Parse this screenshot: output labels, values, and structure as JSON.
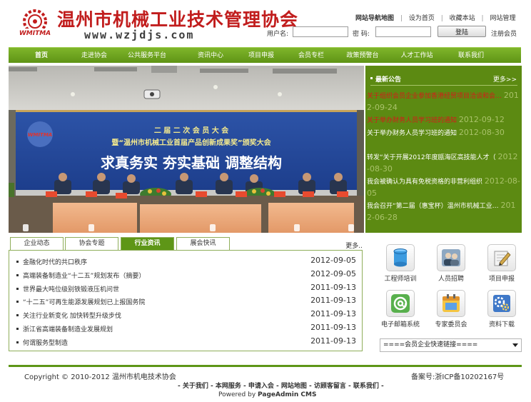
{
  "header": {
    "logo_text": "WMITMA",
    "site_title": "温州市机械工业技术管理协会",
    "site_url": "www.wzjdjs.com",
    "top_links": [
      "网站导航地图",
      "设为首页",
      "收藏本站",
      "网站管理"
    ],
    "username_label": "用户名:",
    "password_label": "密  码:",
    "username_value": "",
    "password_value": "",
    "login_button": "登陆",
    "register_link": "注册会员"
  },
  "nav": {
    "items": [
      "首页",
      "走进协会",
      "公共服务平台",
      "资讯中心",
      "项目申报",
      "会员专栏",
      "政策预警台",
      "人才工作站",
      "联系我们"
    ]
  },
  "banner": {
    "line1": "二 届 二 次 会 员 大 会",
    "line2": "暨“温州市机械工业首届产品创新成果奖”颁奖大会",
    "slogan": "求真务实   夯实基础   调整结构",
    "logo_text": "WMITMA"
  },
  "news": {
    "title": "最新公告",
    "more": "更多>>",
    "items": [
      {
        "title": "关于组织会员企业参加香港经贸项目洽谈和会…",
        "date": "2012-09-24",
        "red": true
      },
      {
        "title": "关于举办财务人员学习班的通知",
        "date": "2012-09-12",
        "red": true
      },
      {
        "title": "关于举办财务人员学习班的通知",
        "date": "2012-08-30",
        "red": false
      },
      {
        "title": "转发“关于开展2012年度瓯海区高技能人才（",
        "date": "2012-08-30",
        "red": false
      },
      {
        "title": "我会被确认为具有免税资格的非营利组织",
        "date": "2012-08-05",
        "red": false
      },
      {
        "title": "我会召开“第二届（惠宝杯）温州市机械工业…",
        "date": "2012-06-28",
        "red": false
      }
    ]
  },
  "tabs": {
    "items": [
      "企业动态",
      "协会专题",
      "行业资讯",
      "展会快讯"
    ],
    "active_index": 2,
    "more": "更多.."
  },
  "article_list": [
    {
      "title": "金融化时代的共口秩序",
      "date": "2012-09-05"
    },
    {
      "title": "高端装备制造业“十二五”规划发布（摘要）",
      "date": "2012-09-05"
    },
    {
      "title": "世界最大吨位级别铁锻液压机问世",
      "date": "2011-09-13"
    },
    {
      "title": "“十二五”可再生能源发展规划已上报国务院",
      "date": "2011-09-13"
    },
    {
      "title": "关注行业新变化  加快转型升级步伐",
      "date": "2011-09-13"
    },
    {
      "title": "浙江省高端装备制造业发展规划",
      "date": "2011-09-13"
    },
    {
      "title": "何谓服务型制造",
      "date": "2011-09-13"
    }
  ],
  "services": [
    {
      "label": "工程师培训",
      "icon": "cylinder-icon"
    },
    {
      "label": "人员招聘",
      "icon": "people-icon"
    },
    {
      "label": "项目申报",
      "icon": "pen-icon"
    },
    {
      "label": "电子邮箱系统",
      "icon": "email-icon"
    },
    {
      "label": "专家委员会",
      "icon": "calendar-icon"
    },
    {
      "label": "资料下载",
      "icon": "gears-icon"
    }
  ],
  "quick_link_select": "====会员企业快速链接====",
  "footer": {
    "copyright": "Copyright © 2010-2012  温州市机电技术协会",
    "icp": "备案号:浙ICP备10202167号",
    "links": "- 关于我们 - 本网服务 - 申请入会 - 网站地图 - 访顾客留言 - 联系我们 -",
    "powered_prefix": "Powered by ",
    "powered_name": "PageAdmin CMS"
  },
  "colors": {
    "brand_green": "#5e9617",
    "title_red": "#c11d1d",
    "news_red": "#d61a1a"
  }
}
